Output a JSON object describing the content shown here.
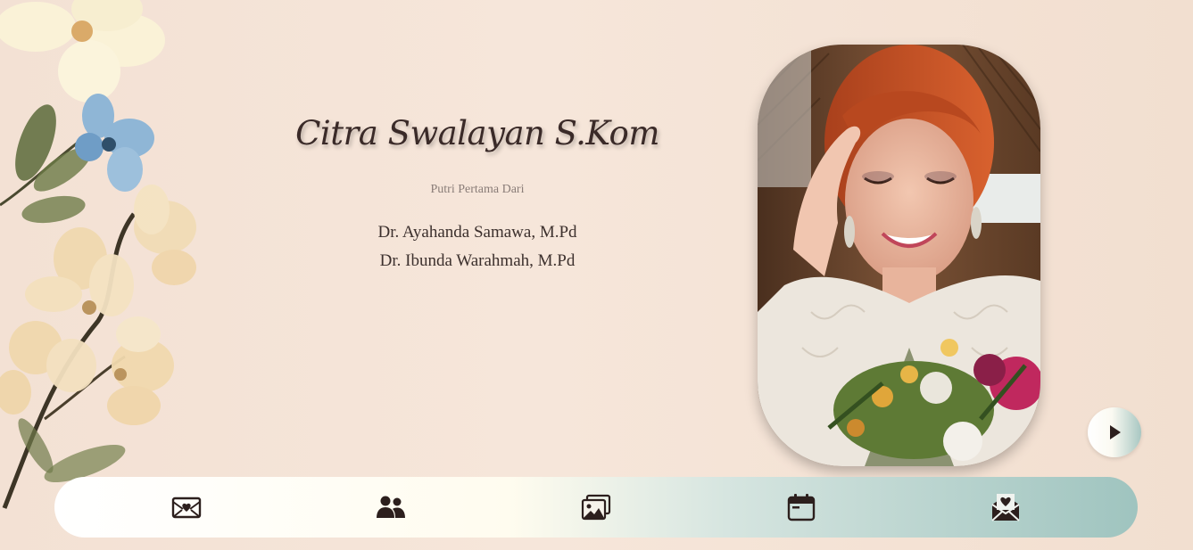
{
  "profile": {
    "name": "Citra Swalayan S.Kom",
    "subtitle": "Putri Pertama Dari",
    "father": "Dr. Ayahanda Samawa, M.Pd",
    "mother": "Dr. Ibunda Warahmah, M.Pd"
  },
  "music_button": {
    "icon": "play-icon"
  },
  "bottom_nav": {
    "items": [
      {
        "icon": "envelope-heart-icon"
      },
      {
        "icon": "couple-icon"
      },
      {
        "icon": "gallery-icon"
      },
      {
        "icon": "calendar-icon"
      },
      {
        "icon": "wedding-gift-icon"
      }
    ]
  },
  "colors": {
    "text_dark": "#3a2a28",
    "nav_teal": "#9fc4bf",
    "background": "#f3e1d4"
  }
}
